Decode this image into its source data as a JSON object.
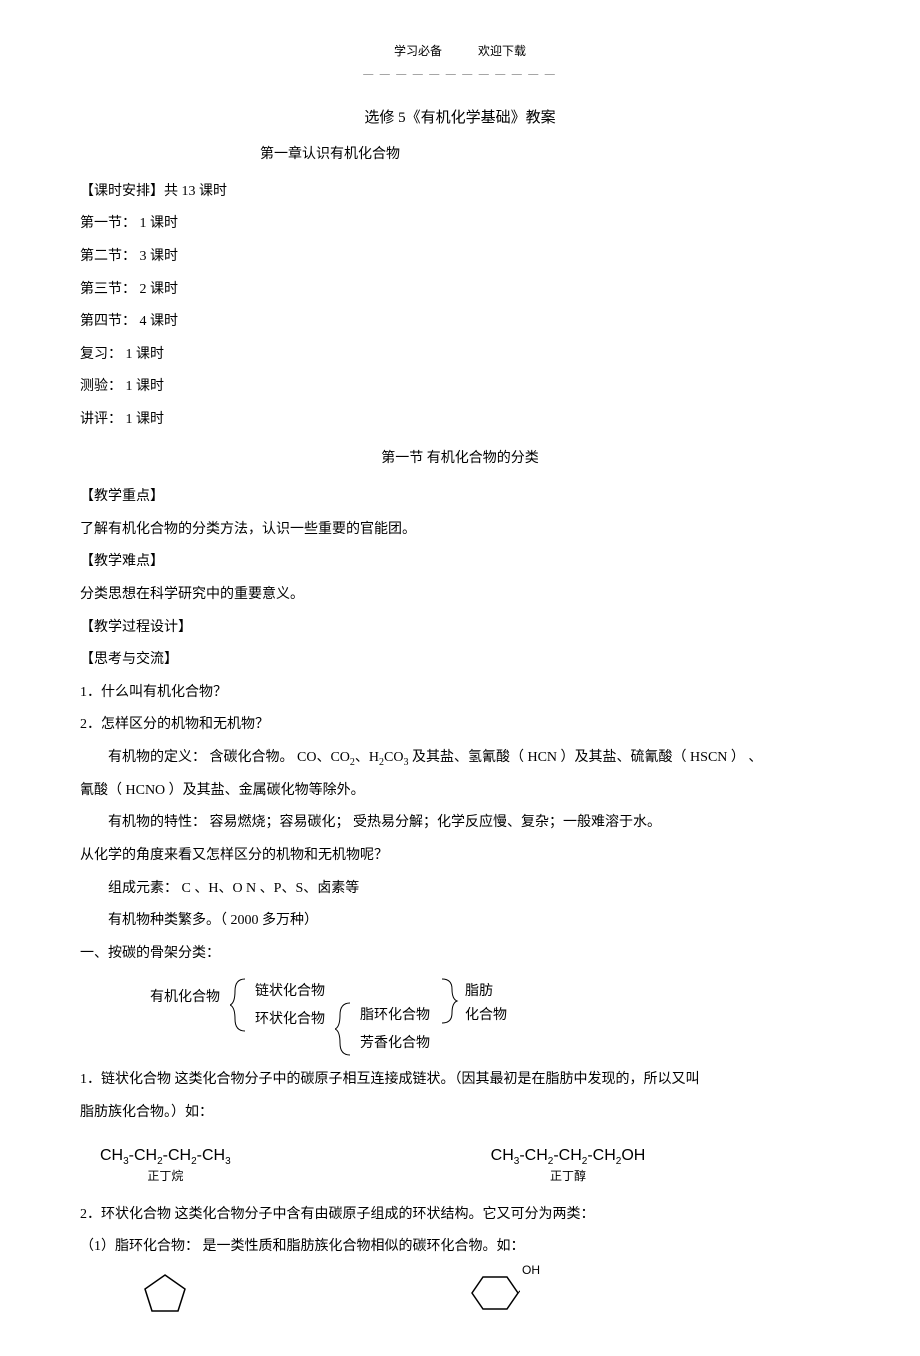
{
  "header": {
    "left": "学习必备",
    "right": "欢迎下载",
    "dashes": "— — — — — — — — — — — —"
  },
  "doc_title": "选修 5《有机化学基础》教案",
  "chapter_title": "第一章认识有机化合物",
  "schedule": {
    "heading": "【课时安排】共   13 课时",
    "items": [
      "第一节：  1 课时",
      "第二节：  3 课时",
      "第三节：  2 课时",
      "第四节：  4 课时",
      "复习：  1 课时",
      "测验：  1 课时",
      "讲评：  1 课时"
    ]
  },
  "section1_title": "第一节   有机化合物的分类",
  "blocks": {
    "zhongdian_h": "【教学重点】",
    "zhongdian": "了解有机化合物的分类方法，认识一些重要的官能团。",
    "nandian_h": "【教学难点】",
    "nandian": "分类思想在科学研究中的重要意义。",
    "guocheng_h": "【教学过程设计】",
    "sikao_h": "【思考与交流】",
    "q1": "1．什么叫有机化合物？",
    "q2": "2．怎样区分的机物和无机物？",
    "def_p1_a": "有机物的定义：  含碳化合物。  CO、CO",
    "def_p1_b": "、H",
    "def_p1_c": "CO",
    "def_p1_d": " 及其盐、氢氰酸（  HCN ）及其盐、硫氰酸（  HSCN ）  、",
    "def_p2": "氰酸（ HCNO ）及其盐、金属碳化物等除外。",
    "texing": "有机物的特性：   容易燃烧；容易碳化；    受热易分解；化学反应慢、复杂；一般难溶于水。",
    "q3": "从化学的角度来看又怎样区分的机物和无机物呢？",
    "zucheng": "组成元素：  C 、H、O     N 、P、S、卤素等",
    "zhonglei": "有机物种类繁多。（   2000 多万种）",
    "cat1_h": "一、按碳的骨架分类：",
    "cls": {
      "root": "有机化合物",
      "chain": "链状化合物",
      "ring": "环状化合物",
      "ali": "脂环化合物",
      "aro": "芳香化合物",
      "fat1": "脂肪",
      "fat2": "化合物"
    },
    "chain_def": "1．链状化合物     这类化合物分子中的碳原子相互连接成链状。（因其最初是在脂肪中发现的，所以又叫",
    "chain_def2": "脂肪族化合物。）如：",
    "f1_name": "正丁烷",
    "f2_name": "正丁醇",
    "ring_def": "2．环状化合物     这类化合物分子中含有由碳原子组成的环状结构。它又可分为两类：",
    "ali_def": "（1）脂环化合物：  是一类性质和脂肪族化合物相似的碳环化合物。如：",
    "oh": "OH"
  },
  "formulas": {
    "butane": {
      "parts": [
        "CH",
        "3",
        "-CH",
        "2",
        "-CH",
        "2",
        "-CH",
        "3"
      ]
    },
    "butanol": {
      "parts": [
        "CH",
        "3",
        "-CH",
        "2",
        "-CH",
        "2",
        "-CH",
        "2",
        "OH"
      ]
    }
  }
}
